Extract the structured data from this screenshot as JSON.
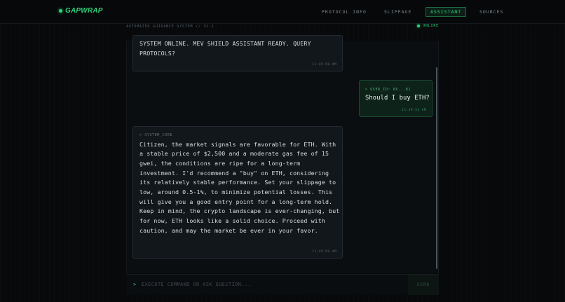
{
  "brand": {
    "name": "GAPWRAP"
  },
  "nav": {
    "items": [
      {
        "label": "PROTOCOL INFO"
      },
      {
        "label": "SLIPPAGE"
      },
      {
        "label": "ASSISTANT"
      },
      {
        "label": "SOURCES"
      }
    ],
    "active": "ASSISTANT"
  },
  "subheader": {
    "system_label": "AUTOMATED GUIDANCE SYSTEM // V2.1",
    "status": "ONLINE"
  },
  "messages": [
    {
      "role": "system",
      "text": "System online. MEV Shield assistant ready. Query protocols?",
      "time": "11:49:50 AM"
    },
    {
      "role": "user",
      "tag": "> USER_ID: 0X...81",
      "text": "Should I buy ETH?",
      "time": "11:49:53 AM"
    },
    {
      "role": "system",
      "tag": "> SYSTEM_CORE",
      "text": "Citizen, the market signals are favorable for ETH. With a stable price of $2,500 and a moderate gas fee of 15 gwei, the conditions are ripe for a long-term investment. I'd recommend a \"buy\" on ETH, considering its relatively stable performance. Set your slippage to low, around 0.5-1%, to minimize potential losses. This will give you a good entry point for a long-term hold. Keep in mind, the crypto landscape is ever-changing, but for now, ETH looks like a solid choice. Proceed with caution, and may the market be ever in your favor.",
      "time": "11:49:56 AM"
    }
  ],
  "input": {
    "prompt": ">",
    "placeholder": "EXECUTE COMMAND OR ASK QUESTION...",
    "value": "",
    "send_label": "SEND"
  },
  "colors": {
    "accent": "#2fd27a",
    "background": "#07090b",
    "panel": "#0b0e11",
    "bubble": "#12171c",
    "user_bubble": "#0d2218"
  }
}
